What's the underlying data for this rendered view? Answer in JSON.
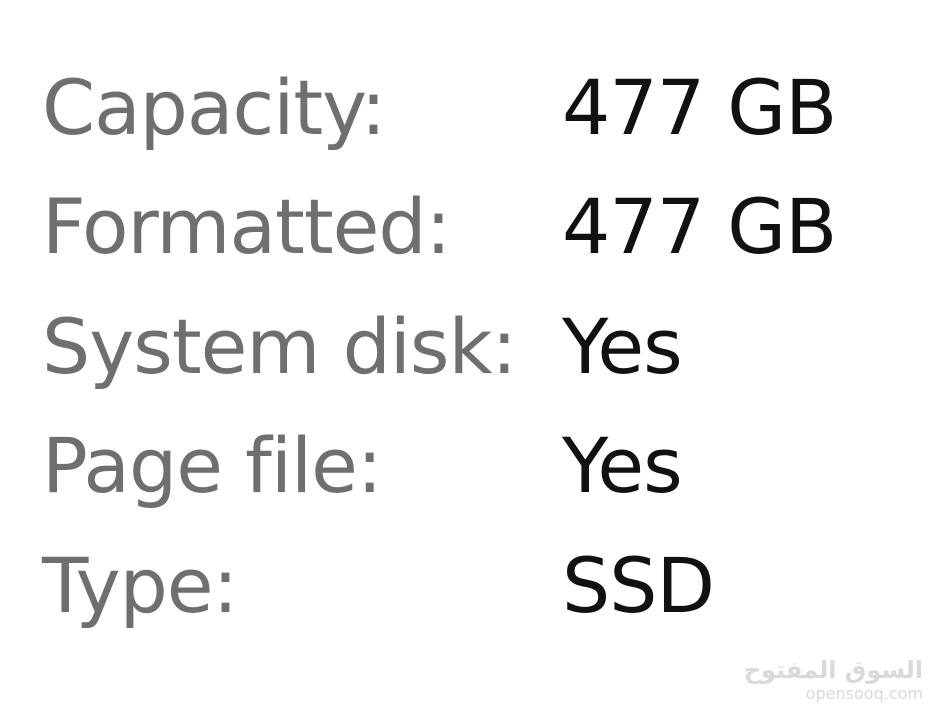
{
  "details": [
    {
      "label": "Capacity:",
      "value": "477 GB"
    },
    {
      "label": "Formatted:",
      "value": "477 GB"
    },
    {
      "label": "System disk:",
      "value": "Yes"
    },
    {
      "label": "Page file:",
      "value": "Yes"
    },
    {
      "label": "Type:",
      "value": "SSD"
    }
  ],
  "watermark": {
    "arabic": "السوق المفتوح",
    "latin": "opensooq.com"
  },
  "colors": {
    "label": "#6f6f6f",
    "value": "#111111",
    "background": "#ffffff",
    "watermark": "#d9d9d9"
  }
}
